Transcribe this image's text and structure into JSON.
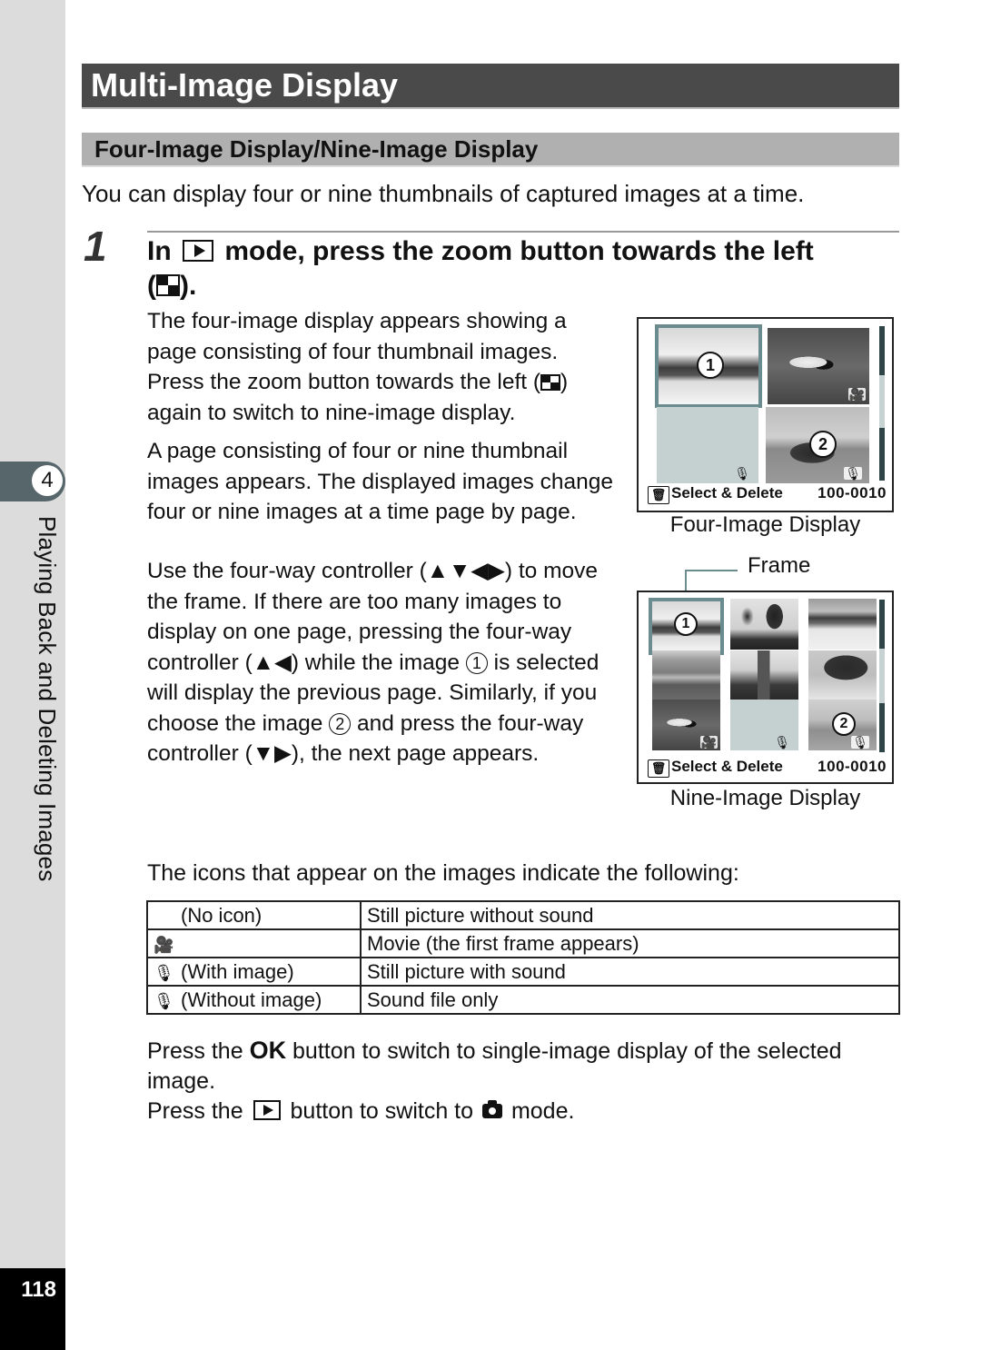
{
  "sidebar": {
    "chapter_number": "4",
    "chapter_title": "Playing Back and Deleting Images",
    "page_number": "118"
  },
  "header": {
    "title": "Multi-Image Display",
    "subtitle": "Four-Image Display/Nine-Image Display",
    "intro": "You can display four or nine thumbnails of captured images at a time."
  },
  "step": {
    "number": "1",
    "heading_part1": "In",
    "heading_part2": "mode, press the zoom button towards the left",
    "heading_part3_open": "(",
    "heading_part3_close": ")."
  },
  "paragraphs": {
    "p1_a": "The four-image display appears showing a page consisting of four thumbnail images. Press the zoom button towards the left (",
    "p1_b": ") again to switch to nine-image display.",
    "p2": "A page consisting of four or nine thumbnail images appears. The displayed images change four or nine images at a time page by page.",
    "p3_a": "Use the four-way controller (▲▼◀▶) to move the frame. If there are too many images to display on one page, pressing the four-way controller (▲◀) while the image",
    "p3_circ1": "1",
    "p3_b": "is selected will display the previous page. Similarly, if you choose the image",
    "p3_circ2": "2",
    "p3_c": "and press the four-way controller (▼▶), the next page appears."
  },
  "four_image_screen": {
    "footer_label": "Select & Delete",
    "file_number": "100-0010",
    "caption": "Four-Image Display",
    "badge1": "1",
    "badge2": "2",
    "scroll_position": 0.45
  },
  "nine_image_screen": {
    "footer_label": "Select & Delete",
    "file_number": "100-0010",
    "caption": "Nine-Image Display",
    "frame_label": "Frame",
    "badge1": "1",
    "badge2": "2",
    "scroll_position": 0.45
  },
  "icons_section": {
    "intro": "The icons that appear on the images indicate the following:",
    "rows": [
      {
        "icon": "",
        "icon_name": "none",
        "label": "(No icon)",
        "meaning": "Still picture without sound"
      },
      {
        "icon": "🎥",
        "icon_name": "movie-icon",
        "label": "",
        "meaning": "Movie (the first frame appears)"
      },
      {
        "icon": "🎙",
        "icon_name": "microphone-icon",
        "label": "(With image)",
        "meaning": "Still picture with sound"
      },
      {
        "icon": "🎙",
        "icon_name": "microphone-icon",
        "label": "(Without image)",
        "meaning": "Sound file only"
      }
    ]
  },
  "footer_notes": {
    "ok_a": "Press the",
    "ok_key": "OK",
    "ok_b": "button to switch to single-image display of the selected image.",
    "play_a": "Press the",
    "play_b": "button to switch to",
    "play_c": "mode."
  },
  "icons": {
    "trash": "🗑",
    "mic": "🎙",
    "movie": "🎥"
  }
}
